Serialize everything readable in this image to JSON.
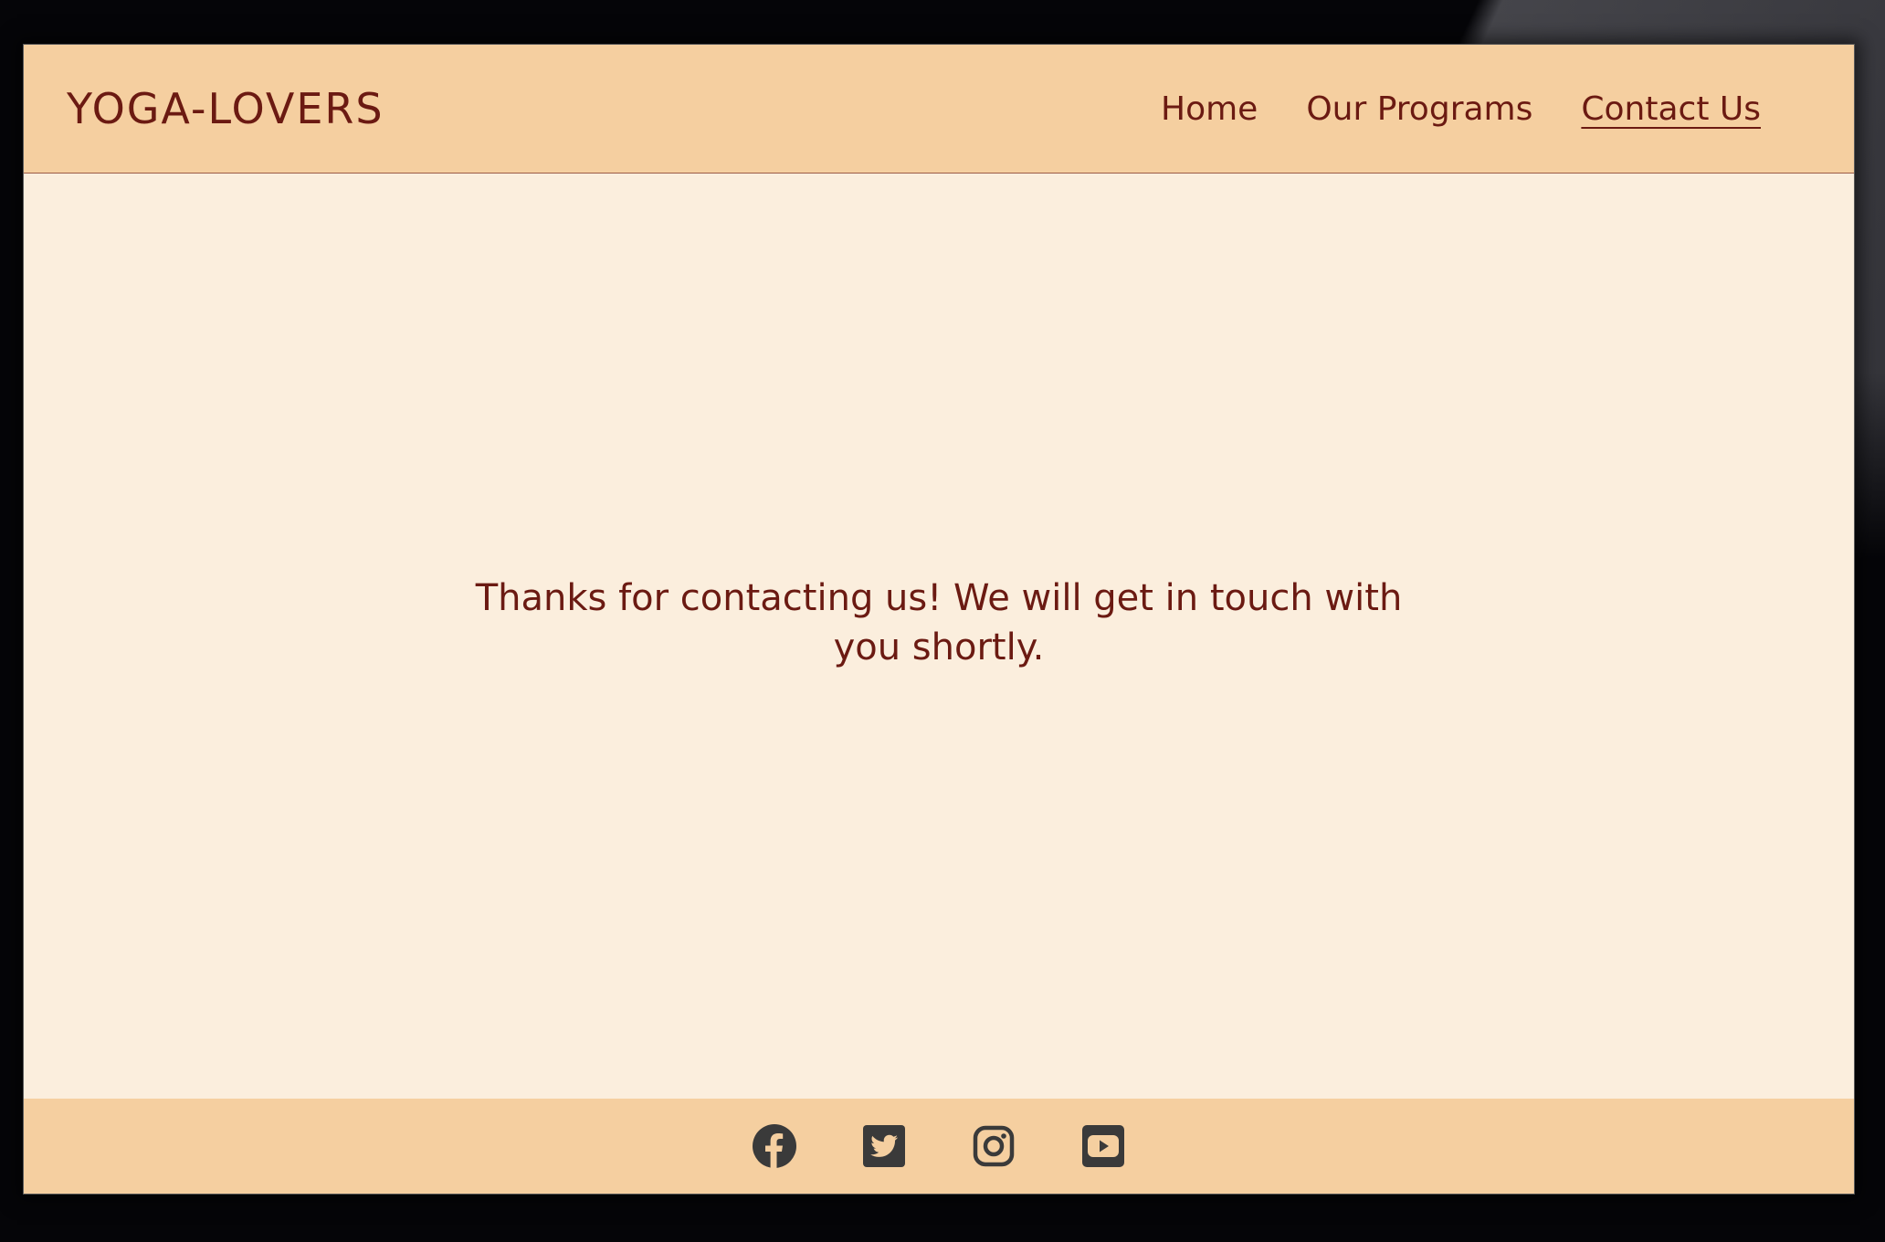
{
  "site": {
    "logo": "YOGA-LOVERS"
  },
  "nav": {
    "items": [
      {
        "label": "Home",
        "active": false
      },
      {
        "label": "Our Programs",
        "active": false
      },
      {
        "label": "Contact Us",
        "active": true
      }
    ]
  },
  "main": {
    "message": "Thanks for contacting us! We will get in touch with you shortly."
  },
  "footer": {
    "social": [
      {
        "icon": "facebook-icon"
      },
      {
        "icon": "twitter-icon"
      },
      {
        "icon": "instagram-icon"
      },
      {
        "icon": "youtube-icon"
      }
    ]
  },
  "colors": {
    "header_bg": "#f5cfa0",
    "page_bg": "#fbeedd",
    "text_brand": "#6b1a12",
    "icon_color": "#3a3a3a"
  }
}
